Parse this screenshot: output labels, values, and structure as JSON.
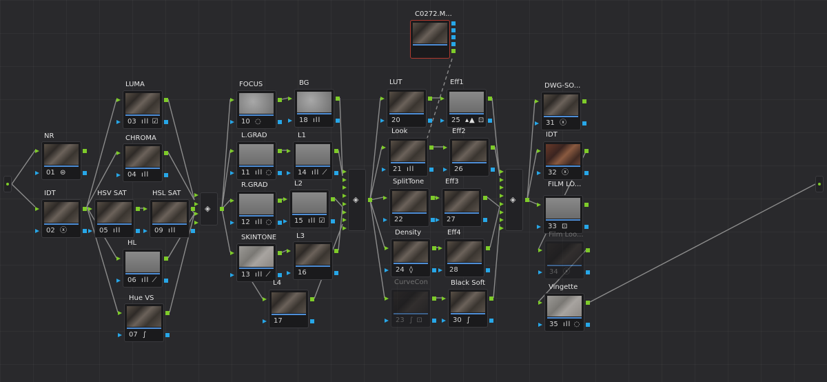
{
  "source_label": "C0272.M...",
  "colors": {
    "rgb_port": "#7ecb2a",
    "key_port": "#27a7e8",
    "wire": "#8c8c8c",
    "selected_outline": "#b23a2e",
    "bar": "#4f8fd8"
  },
  "nodes": [
    {
      "id": "src",
      "label": "C0272.M...",
      "number": "",
      "icons": "",
      "selected": true
    },
    {
      "id": "n01",
      "label": "NR",
      "number": "01",
      "icons": "⊜"
    },
    {
      "id": "n02",
      "label": "IDT",
      "number": "02",
      "icons": "ⓧ"
    },
    {
      "id": "n03",
      "label": "LUMA",
      "number": "03",
      "icons": "ıll ☑"
    },
    {
      "id": "n04",
      "label": "CHROMA",
      "number": "04",
      "icons": "ıll"
    },
    {
      "id": "n05",
      "label": "HSV SAT",
      "number": "05",
      "icons": "ıll"
    },
    {
      "id": "n09",
      "label": "HSL SAT",
      "number": "09",
      "icons": "ıll"
    },
    {
      "id": "n06",
      "label": "HL",
      "number": "06",
      "icons": "ıll ⟋"
    },
    {
      "id": "n07",
      "label": "Hue VS",
      "number": "07",
      "icons": "∫"
    },
    {
      "id": "n10",
      "label": "FOCUS",
      "number": "10",
      "icons": "◌"
    },
    {
      "id": "n11",
      "label": "L.GRAD",
      "number": "11",
      "icons": "ıll ◌"
    },
    {
      "id": "n12",
      "label": "R.GRAD",
      "number": "12",
      "icons": "ıll ◌"
    },
    {
      "id": "n13",
      "label": "SKINTONE",
      "number": "13",
      "icons": "ıll ⟋"
    },
    {
      "id": "n18",
      "label": "BG",
      "number": "18",
      "icons": "ıll"
    },
    {
      "id": "n14",
      "label": "L1",
      "number": "14",
      "icons": "ıll ⟋"
    },
    {
      "id": "n15",
      "label": "L2",
      "number": "15",
      "icons": "ıll ☑"
    },
    {
      "id": "n16",
      "label": "L3",
      "number": "16",
      "icons": ""
    },
    {
      "id": "n17",
      "label": "L4",
      "number": "17",
      "icons": ""
    },
    {
      "id": "n20",
      "label": "LUT",
      "number": "20",
      "icons": ""
    },
    {
      "id": "n21",
      "label": "Look",
      "number": "21",
      "icons": "ıll"
    },
    {
      "id": "n22",
      "label": "SplitTone",
      "number": "22",
      "icons": ""
    },
    {
      "id": "n24",
      "label": "Density",
      "number": "24",
      "icons": "◊"
    },
    {
      "id": "n23",
      "label": "CurveCon",
      "number": "23",
      "icons": "∫ ⊡",
      "dim": true
    },
    {
      "id": "n25",
      "label": "Eff1",
      "number": "25",
      "icons": "▴▲ ⊡"
    },
    {
      "id": "n26",
      "label": "Eff2",
      "number": "26",
      "icons": ""
    },
    {
      "id": "n27",
      "label": "Eff3",
      "number": "27",
      "icons": ""
    },
    {
      "id": "n28",
      "label": "Eff4",
      "number": "28",
      "icons": ""
    },
    {
      "id": "n30",
      "label": "Black Soft",
      "number": "30",
      "icons": "∫"
    },
    {
      "id": "n31",
      "label": "DWG-SO...",
      "number": "31",
      "icons": "ⓧ"
    },
    {
      "id": "n32",
      "label": "IDT",
      "number": "32",
      "icons": "ⓧ"
    },
    {
      "id": "n33",
      "label": "FILM LO...",
      "number": "33",
      "icons": "⊡"
    },
    {
      "id": "n34",
      "label": "Film Loo...",
      "number": "34",
      "icons": "ⓧ",
      "dim": true
    },
    {
      "id": "n35",
      "label": "Vingette",
      "number": "35",
      "icons": "ıll ◌"
    }
  ],
  "mixers": [
    {
      "id": "m1",
      "icon": "◈"
    },
    {
      "id": "m2",
      "icon": "◈"
    },
    {
      "id": "m3",
      "icon": "◈"
    }
  ]
}
